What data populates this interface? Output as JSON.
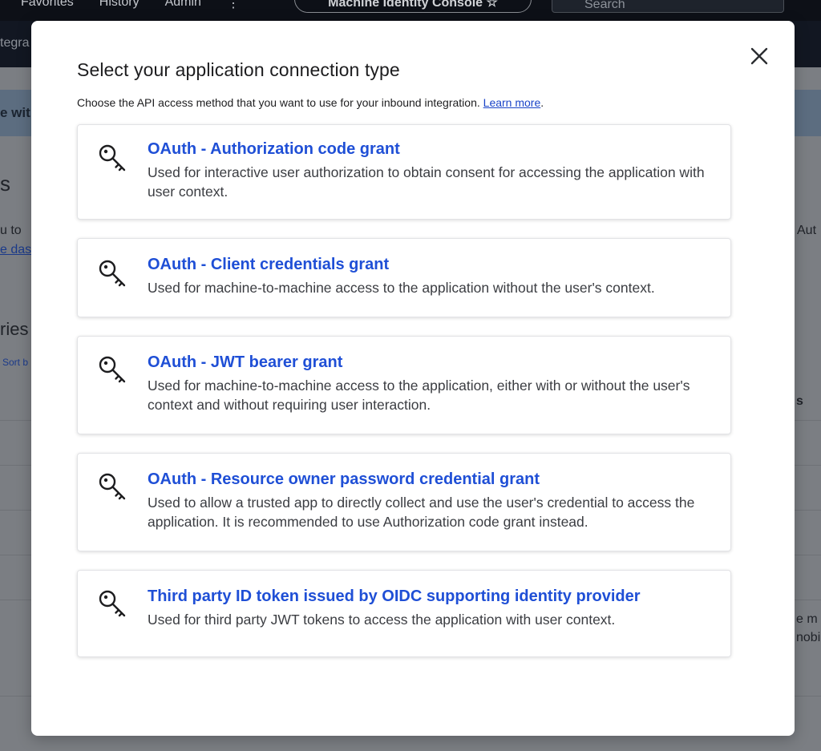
{
  "background": {
    "nav": [
      "Favorites",
      "History",
      "Admin",
      "⋮"
    ],
    "console_pill": "Machine Identity Console ☆",
    "search_placeholder": "Search",
    "subbar_fragment": "tegra",
    "banner_fragment": "e wit",
    "fragments": {
      "heading": "s",
      "line1": "u to",
      "link": "e das",
      "section": "ries",
      "sort": "Sort b",
      "right1": "Aut",
      "right2": "s",
      "right3": "e m",
      "right4": "nobi"
    }
  },
  "modal": {
    "title": "Select your application connection type",
    "description": "Choose the API access method that you want to use for your inbound integration. ",
    "learn_more": "Learn more",
    "period": ".",
    "close_icon": "close-icon",
    "options": [
      {
        "icon": "key-icon",
        "title": "OAuth - Authorization code grant",
        "description": "Used for interactive user authorization to obtain consent for accessing the application with user context."
      },
      {
        "icon": "key-icon",
        "title": "OAuth - Client credentials grant",
        "description": "Used for machine-to-machine access to the application without the user's context."
      },
      {
        "icon": "key-icon",
        "title": "OAuth - JWT bearer grant",
        "description": "Used for machine-to-machine access to the application, either with or without the user's context and without requiring user interaction."
      },
      {
        "icon": "key-icon",
        "title": "OAuth - Resource owner password credential grant",
        "description": "Used to allow a trusted app to directly collect and use the user's credential to access the application. It is recommended to use Authorization code grant instead."
      },
      {
        "icon": "key-icon",
        "title": "Third party ID token issued by OIDC supporting identity provider",
        "description": "Used for third party JWT tokens to access the application with user context."
      }
    ]
  },
  "colors": {
    "link_blue": "#1f4fd6",
    "overlay": "#7b7e83",
    "topbar": "#0d1017"
  }
}
